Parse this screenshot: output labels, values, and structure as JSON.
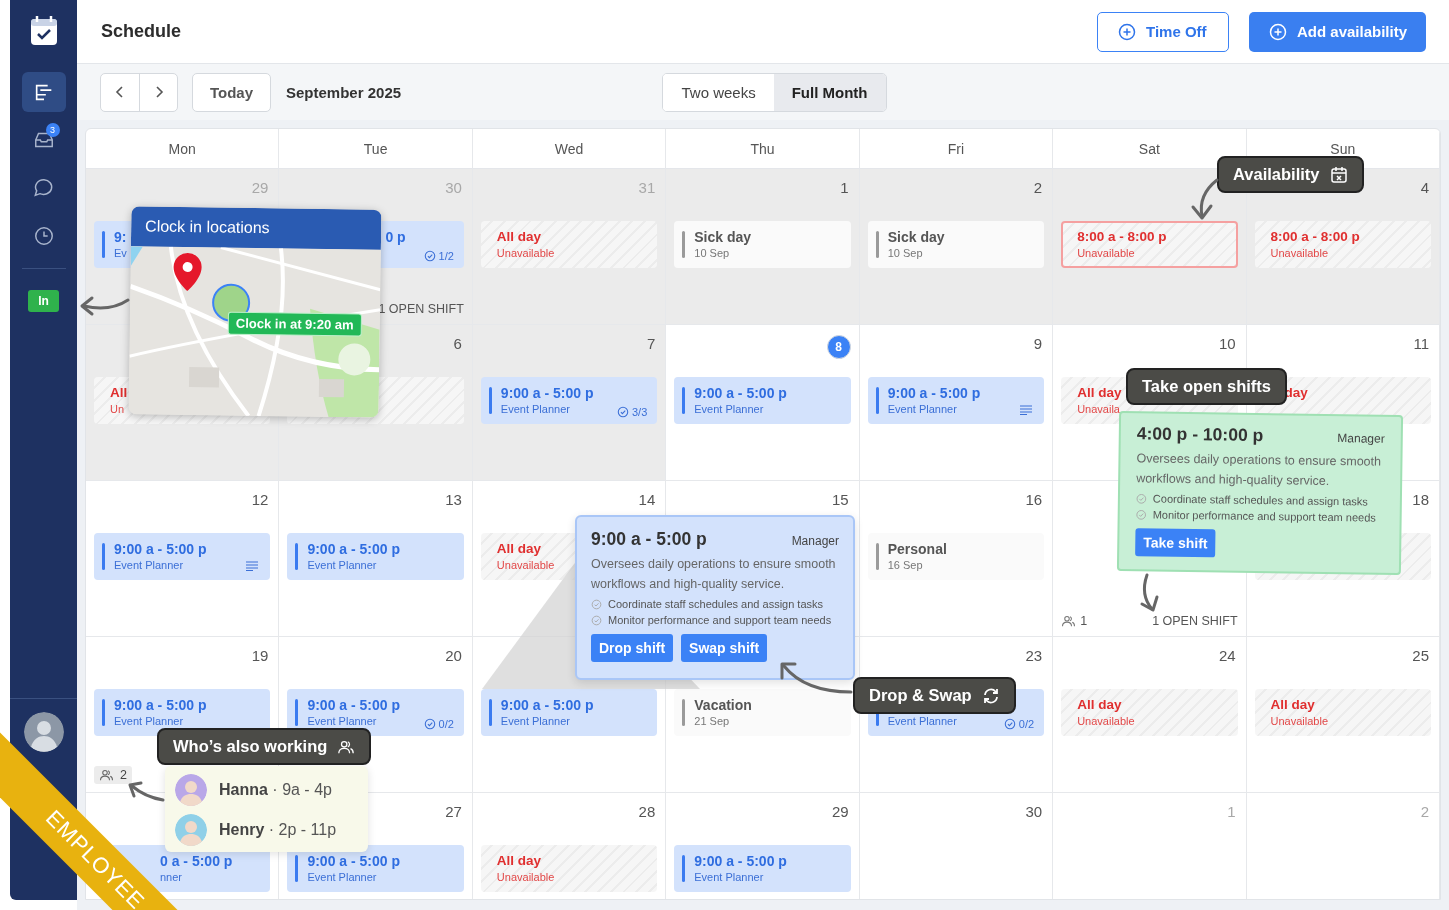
{
  "sidebar": {
    "items": [
      {
        "kind": "schedule",
        "selected": true
      },
      {
        "kind": "inbox",
        "selected": false,
        "badge": "3"
      },
      {
        "kind": "chat",
        "selected": false
      },
      {
        "kind": "clock",
        "selected": false
      }
    ],
    "clock_button": "In"
  },
  "header": {
    "title": "Schedule",
    "buttons": [
      {
        "label": "Time Off",
        "kind": "outline"
      },
      {
        "label": "Add availability",
        "kind": "primary"
      }
    ]
  },
  "toolbar": {
    "today": "Today",
    "month": "September 2025",
    "views": [
      {
        "label": "Two weeks",
        "selected": false
      },
      {
        "label": "Full Month",
        "selected": true
      }
    ]
  },
  "calendar": {
    "weekdays": [
      "Mon",
      "Tue",
      "Wed",
      "Thu",
      "Fri",
      "Sat",
      "Sun"
    ],
    "weeks": [
      [
        {
          "day": "29",
          "outside": true,
          "past": true,
          "today": false,
          "events": [
            {
              "kind": "shift",
              "time": "9:",
              "role": "Ev"
            }
          ]
        },
        {
          "day": "30",
          "outside": true,
          "past": true,
          "today": false,
          "events": [
            {
              "kind": "shift",
              "time": "0 p",
              "badge": "1/2",
              "notes": false
            }
          ],
          "footer": {
            "kind": "open",
            "open_shifts": "1 OPEN SHIFT"
          }
        },
        {
          "day": "31",
          "outside": true,
          "past": true,
          "today": false,
          "events": [
            {
              "kind": "unavailable",
              "title": "All day",
              "subtitle": "Unavailable",
              "highlighted": false
            }
          ]
        },
        {
          "day": "1",
          "outside": false,
          "past": true,
          "today": false,
          "events": [
            {
              "kind": "leave",
              "title": "Sick day",
              "subtitle": "10 Sep"
            }
          ]
        },
        {
          "day": "2",
          "outside": false,
          "past": true,
          "today": false,
          "events": [
            {
              "kind": "leave",
              "title": "Sick day",
              "subtitle": "10 Sep"
            }
          ]
        },
        {
          "past": true,
          "events": [
            {
              "kind": "unavailable",
              "title": "8:00 a - 8:00 p",
              "subtitle": "Unavailable",
              "highlighted": true
            }
          ]
        },
        {
          "day": "4",
          "outside": false,
          "past": true,
          "today": false,
          "events": [
            {
              "kind": "unavailable",
              "title": "8:00 a - 8:00 p",
              "subtitle": "Unavailable",
              "highlighted": false
            }
          ]
        }
      ],
      [
        {
          "past": true,
          "events": [
            {
              "kind": "unavailable",
              "title": "All",
              "subtitle": "Un",
              "highlighted": false
            }
          ]
        },
        {
          "day": "6",
          "outside": false,
          "past": true,
          "today": false,
          "events": [
            {
              "kind": "unavailable",
              "highlighted": false
            }
          ]
        },
        {
          "day": "7",
          "outside": false,
          "past": true,
          "today": false,
          "events": [
            {
              "kind": "shift",
              "time": "9:00 a - 5:00 p",
              "role": "Event Planner",
              "badge": "3/3",
              "notes": false
            }
          ]
        },
        {
          "day": "8",
          "outside": false,
          "past": false,
          "today": true,
          "events": [
            {
              "kind": "shift",
              "time": "9:00 a - 5:00 p",
              "role": "Event Planner",
              "notes": false
            }
          ]
        },
        {
          "day": "9",
          "outside": false,
          "past": false,
          "today": false,
          "events": [
            {
              "kind": "shift",
              "time": "9:00 a - 5:00 p",
              "role": "Event Planner",
              "notes": true
            }
          ]
        },
        {
          "day": "10",
          "outside": false,
          "past": false,
          "today": false,
          "events": [
            {
              "kind": "unavailable",
              "title": "All day",
              "subtitle": "Unavaila",
              "highlighted": false
            }
          ]
        },
        {
          "day": "11",
          "outside": false,
          "past": false,
          "today": false,
          "events": [
            {
              "kind": "unavailable",
              "title": "day",
              "highlighted": false
            }
          ]
        }
      ],
      [
        {
          "day": "12",
          "outside": false,
          "past": false,
          "today": false,
          "events": [
            {
              "kind": "shift",
              "time": "9:00 a - 5:00 p",
              "role": "Event Planner",
              "notes": true
            }
          ]
        },
        {
          "day": "13",
          "outside": false,
          "past": false,
          "today": false,
          "events": [
            {
              "kind": "shift",
              "time": "9:00 a - 5:00 p",
              "role": "Event Planner",
              "notes": false
            }
          ]
        },
        {
          "day": "14",
          "outside": false,
          "past": false,
          "today": false,
          "events": [
            {
              "kind": "unavailable",
              "title": "All day",
              "subtitle": "Unavailable",
              "highlighted": false
            }
          ]
        },
        {
          "day": "15",
          "outside": false,
          "past": false,
          "today": false
        },
        {
          "day": "16",
          "outside": false,
          "past": false,
          "today": false,
          "events": [
            {
              "kind": "leave",
              "title": "Personal",
              "subtitle": "16 Sep"
            }
          ]
        },
        {
          "past": false,
          "footer": {
            "kind": "open",
            "people": "1",
            "open_shifts": "1 OPEN SHIFT"
          }
        },
        {
          "day": "18",
          "outside": false,
          "past": false,
          "today": false,
          "events": [
            {
              "kind": "unavailable",
              "highlighted": false
            }
          ]
        }
      ],
      [
        {
          "day": "19",
          "outside": false,
          "past": false,
          "today": false,
          "events": [
            {
              "kind": "shift",
              "time": "9:00 a - 5:00 p",
              "role": "Event Planner",
              "notes": false
            }
          ],
          "footer": {
            "kind": "chip",
            "people": "2"
          }
        },
        {
          "day": "20",
          "outside": false,
          "past": false,
          "today": false,
          "events": [
            {
              "kind": "shift",
              "time": "9:00 a - 5:00 p",
              "role": "Event Planner",
              "badge": "0/2",
              "notes": false
            }
          ]
        },
        {
          "past": false,
          "events": [
            {
              "kind": "shift",
              "time": "9:00 a - 5:00 p",
              "role": "Event Planner",
              "notes": false
            }
          ]
        },
        {
          "past": false,
          "events": [
            {
              "kind": "leave",
              "title": "Vacation",
              "subtitle": "21 Sep"
            }
          ]
        },
        {
          "day": "23",
          "outside": false,
          "past": false,
          "today": false,
          "events": [
            {
              "kind": "shift",
              "role": "Event Planner",
              "badge": "0/2",
              "notes": false
            }
          ]
        },
        {
          "day": "24",
          "outside": false,
          "past": false,
          "today": false,
          "events": [
            {
              "kind": "unavailable",
              "title": "All day",
              "subtitle": "Unavailable",
              "highlighted": false
            }
          ]
        },
        {
          "day": "25",
          "outside": false,
          "past": false,
          "today": false,
          "events": [
            {
              "kind": "unavailable",
              "title": "All day",
              "subtitle": "Unavailable",
              "highlighted": false
            }
          ]
        }
      ],
      [
        {
          "past": false,
          "events": [
            {
              "kind": "shift",
              "time": "0 a - 5:00 p",
              "role": "nner",
              "notes": false
            }
          ]
        },
        {
          "day": "27",
          "outside": false,
          "past": false,
          "today": false,
          "events": [
            {
              "kind": "shift",
              "time": "9:00 a - 5:00 p",
              "role": "Event Planner",
              "notes": false
            }
          ]
        },
        {
          "day": "28",
          "outside": false,
          "past": false,
          "today": false,
          "events": [
            {
              "kind": "unavailable",
              "title": "All day",
              "subtitle": "Unavailable",
              "highlighted": false
            }
          ]
        },
        {
          "day": "29",
          "outside": false,
          "past": false,
          "today": false,
          "events": [
            {
              "kind": "shift",
              "time": "9:00 a - 5:00 p",
              "role": "Event Planner",
              "notes": false
            }
          ]
        },
        {
          "day": "30",
          "outside": false,
          "past": false,
          "today": false
        },
        {
          "day": "1",
          "outside": true,
          "past": false,
          "today": false
        },
        {
          "day": "2",
          "outside": true,
          "past": false,
          "today": false
        }
      ]
    ]
  },
  "clock_in_card": {
    "title": "Clock in locations",
    "badge": "Clock in at 9:20 am"
  },
  "availability_callout": {
    "label": "Availability"
  },
  "open_shift_callout": {
    "label": "Take open shifts",
    "card": {
      "time": "4:00 p - 10:00 p",
      "role": "Manager",
      "description": "Oversees daily operations to ensure smooth workflows and high-quality service.",
      "tasks": [
        "Coordinate staff schedules and assign tasks",
        "Monitor performance and support team needs"
      ],
      "button": "Take shift"
    }
  },
  "shift_popover": {
    "time": "9:00 a - 5:00 p",
    "role": "Manager",
    "description": "Oversees daily operations to ensure smooth workflows and high-quality service.",
    "tasks": [
      "Coordinate staff schedules and assign tasks",
      "Monitor performance and support team needs"
    ],
    "buttons": [
      "Drop shift",
      "Swap shift"
    ]
  },
  "drop_swap_callout": {
    "label": "Drop & Swap"
  },
  "coworkers_callout": {
    "label": "Who’s also working",
    "people": [
      {
        "text": "**Hanna** · 9a - 4p"
      },
      {
        "text": "**Henry** · 2p - 11p"
      }
    ]
  },
  "ribbon": {
    "label": "EMPLOYEE"
  }
}
